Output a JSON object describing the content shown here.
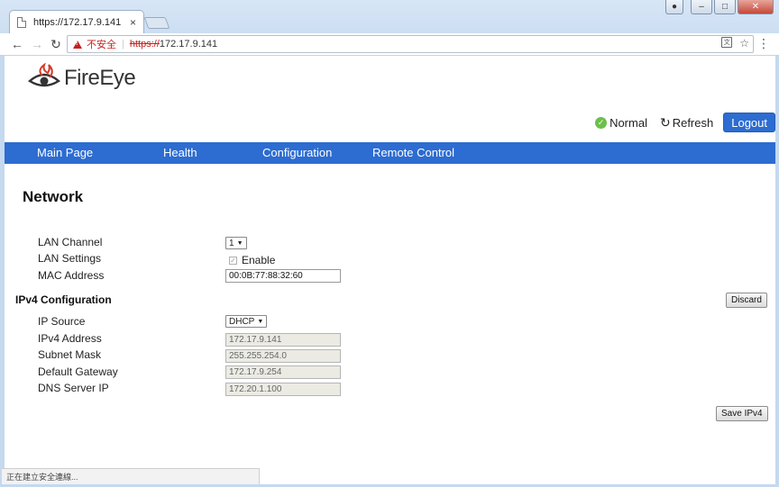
{
  "browser": {
    "tab_title": "https://172.17.9.141",
    "tab_close": "×",
    "security_label": "不安全",
    "url_scheme": "https://",
    "url_host": "172.17.9.141",
    "status_text": "正在建立安全連線..."
  },
  "icons": {
    "back": "arrow-left-icon",
    "forward": "arrow-right-icon",
    "reload": "reload-icon",
    "warning": "warning-triangle-icon",
    "translate": "translate-icon",
    "bookmark": "star-icon",
    "menu": "kebab-menu-icon",
    "check": "check-circle-icon",
    "refresh": "refresh-icon",
    "logo": "fireeye-eye-icon"
  },
  "header": {
    "logo_text": "FireEye",
    "status_label": "Normal",
    "refresh_label": "Refresh",
    "logout_label": "Logout"
  },
  "nav": {
    "items": [
      "Main Page",
      "Health",
      "Configuration",
      "Remote Control"
    ]
  },
  "content": {
    "title": "Network",
    "lan": {
      "channel_label": "LAN Channel",
      "channel_value": "1",
      "settings_label": "LAN Settings",
      "settings_checkbox_label": "Enable",
      "mac_label": "MAC Address",
      "mac_value": "00:0B:77:88:32:60"
    },
    "ipv4": {
      "section_title": "IPv4 Configuration",
      "discard_label": "Discard",
      "source_label": "IP Source",
      "source_value": "DHCP",
      "address_label": "IPv4 Address",
      "address_value": "172.17.9.141",
      "subnet_label": "Subnet Mask",
      "subnet_value": "255.255.254.0",
      "gateway_label": "Default Gateway",
      "gateway_value": "172.17.9.254",
      "dns_label": "DNS Server IP",
      "dns_value": "172.20.1.100",
      "save_label": "Save IPv4"
    }
  },
  "colors": {
    "accent": "#2d6cd0",
    "logo_red": "#d43b2a",
    "ok_green": "#6cc04a",
    "insecure_red": "#c5221f"
  }
}
